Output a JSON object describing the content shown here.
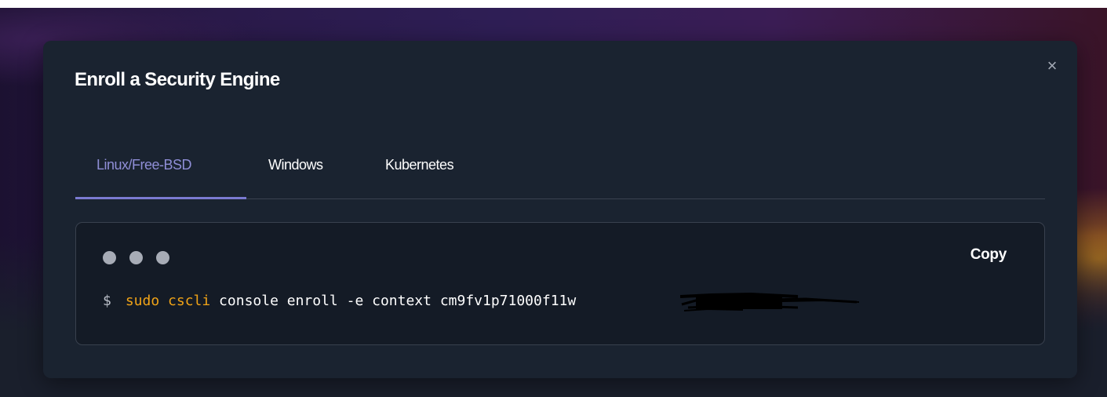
{
  "modal": {
    "title": "Enroll a Security Engine",
    "close_icon": "close-icon"
  },
  "tabs": [
    {
      "label": "Linux/Free-BSD",
      "active": true
    },
    {
      "label": "Windows",
      "active": false
    },
    {
      "label": "Kubernetes",
      "active": false
    }
  ],
  "code_block": {
    "copy_label": "Copy",
    "prompt": "$",
    "keyword": "sudo cscli",
    "command_rest": " console enroll -e context cm9fv1p71000f11w",
    "redacted": true
  },
  "colors": {
    "modal_bg": "#1a2330",
    "accent": "#8f8ed6",
    "keyword": "#f0a317",
    "code_bg": "#141b26"
  }
}
